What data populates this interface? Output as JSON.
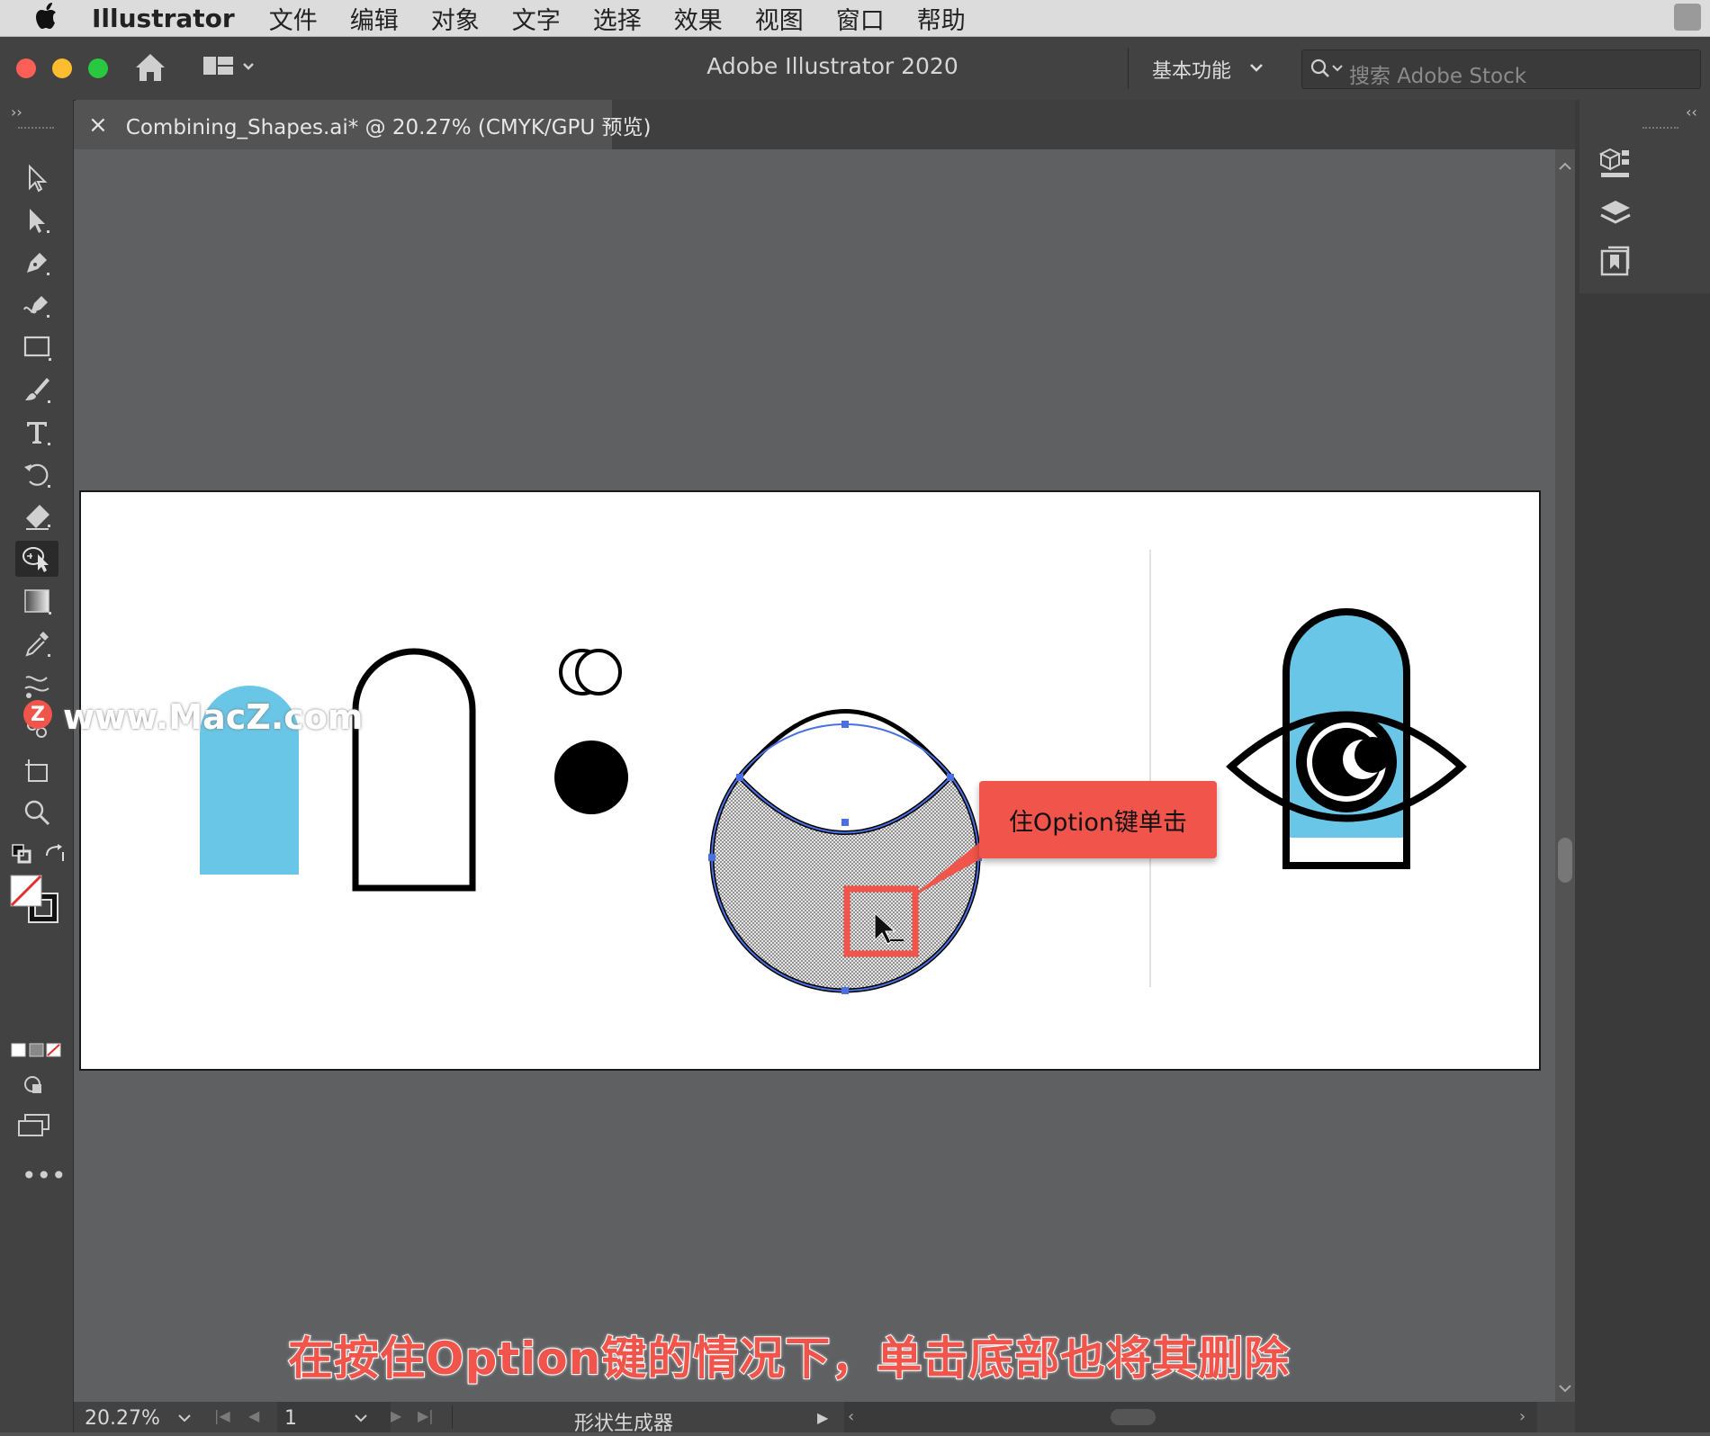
{
  "menubar": {
    "app_name": "Illustrator",
    "items": [
      "文件",
      "编辑",
      "对象",
      "文字",
      "选择",
      "效果",
      "视图",
      "窗口",
      "帮助"
    ]
  },
  "titlebar": {
    "title": "Adobe Illustrator 2020",
    "workspace": "基本功能",
    "search_placeholder": "搜索 Adobe Stock"
  },
  "document_tab": {
    "close": "×",
    "name": "Combining_Shapes.ai* @ 20.27% (CMYK/GPU 预览)"
  },
  "callout": {
    "text": "住Option键单击",
    "color": "#f0544a"
  },
  "subtitle": "在按住Option键的情况下，单击底部也将其删除",
  "watermark": "www.MacZ.com",
  "statusbar": {
    "zoom": "20.27%",
    "artboard_number": "1",
    "current_tool": "形状生成器"
  },
  "colors": {
    "light_blue": "#6ac6e6",
    "accent_red": "#f0544a",
    "selection_blue": "#4a6fe0"
  },
  "tools": [
    "selection-tool",
    "direct-selection-tool",
    "pen-tool",
    "curvature-tool",
    "rectangle-tool",
    "paintbrush-tool",
    "type-tool",
    "rotate-tool",
    "eraser-tool",
    "shape-builder-tool",
    "gradient-tool",
    "eyedropper-tool",
    "blend-tool",
    "symbol-sprayer-tool",
    "artboard-tool",
    "zoom-tool"
  ]
}
